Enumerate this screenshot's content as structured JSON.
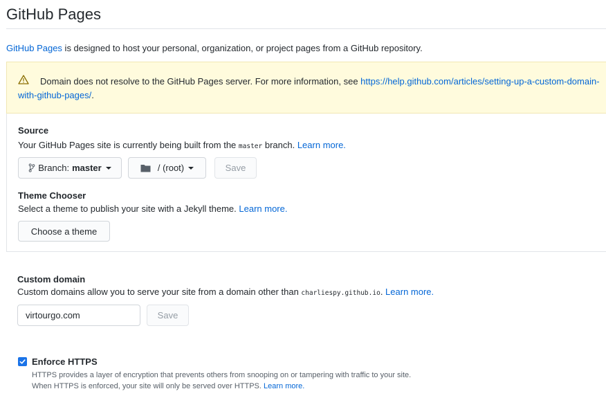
{
  "header": {
    "title": "GitHub Pages"
  },
  "intro": {
    "link": "GitHub Pages",
    "text": " is designed to host your personal, organization, or project pages from a GitHub repository."
  },
  "warning": {
    "text": "Domain does not resolve to the GitHub Pages server. For more information, see ",
    "link": "https://help.github.com/articles/setting-up-a-custom-domain-with-github-pages/",
    "end": "."
  },
  "source": {
    "label": "Source",
    "desc_pre": "Your GitHub Pages site is currently being built from the ",
    "branch_code": "master",
    "desc_post": " branch. ",
    "learn_more": "Learn more.",
    "branch_prefix": "Branch: ",
    "branch_value": "master",
    "folder_value": "/ (root)",
    "save_label": "Save"
  },
  "theme": {
    "label": "Theme Chooser",
    "desc": "Select a theme to publish your site with a Jekyll theme. ",
    "learn_more": "Learn more.",
    "button_label": "Choose a theme"
  },
  "custom_domain": {
    "label": "Custom domain",
    "desc_pre": "Custom domains allow you to serve your site from a domain other than ",
    "domain_code": "charliespy.github.io",
    "desc_post": ". ",
    "learn_more": "Learn more.",
    "input_value": "virtourgo.com",
    "save_label": "Save"
  },
  "https": {
    "label": "Enforce HTTPS",
    "checked": true,
    "line1": "HTTPS provides a layer of encryption that prevents others from snooping on or tampering with traffic to your site.",
    "line2": "When HTTPS is enforced, your site will only be served over HTTPS. ",
    "learn_more": "Learn more."
  },
  "colors": {
    "link": "#0366d6",
    "warning_bg": "#fffbdd",
    "checkbox": "#1a73e8",
    "border": "#e1e4e8"
  }
}
